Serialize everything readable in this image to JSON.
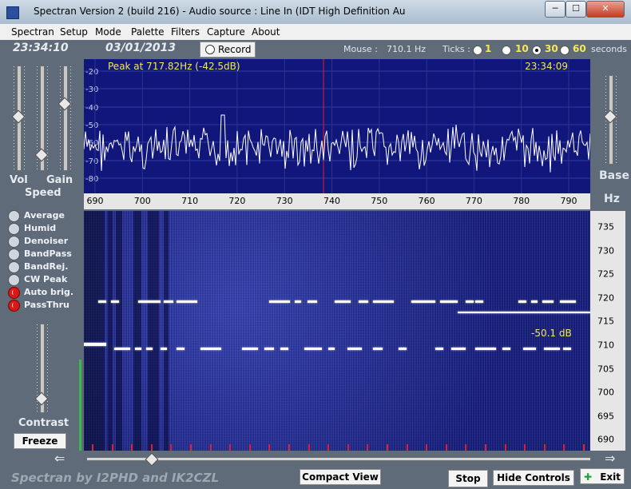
{
  "window": {
    "title": "Spectran Version 2 (build 216) - Audio source  :  Line In (IDT High Definition Au",
    "minimize_glyph": "─",
    "maximize_glyph": "☐",
    "close_glyph": "✕"
  },
  "menu": [
    "Spectran",
    "Setup",
    "Mode",
    "Palette",
    "Filters",
    "Capture",
    "About"
  ],
  "info": {
    "time": "23:34:10",
    "date": "03/01/2013",
    "record_label": "Record",
    "mouse_label": "Mouse :",
    "mouse_value": "710.1 Hz",
    "ticks_label": "Ticks :",
    "tick_options": [
      "1",
      "10",
      "30",
      "60"
    ],
    "tick_selected": "30",
    "seconds_label": "seconds"
  },
  "spectrum": {
    "peak_text": "Peak at  717.82Hz (-42.5dB)",
    "time": "23:34:09",
    "y_ticks": [
      "-20",
      "-30",
      "-40",
      "-50",
      "-60",
      "-70",
      "-80"
    ],
    "x_ticks": [
      "690",
      "700",
      "710",
      "720",
      "730",
      "740",
      "750",
      "760",
      "770",
      "780",
      "790"
    ]
  },
  "waterfall": {
    "db_label": "-50.1 dB",
    "y_ticks": [
      "735",
      "730",
      "725",
      "720",
      "715",
      "710",
      "705",
      "700",
      "695",
      "690"
    ],
    "unit": "Hz"
  },
  "left_panel": {
    "vol_label": "Vol",
    "gain_label": "Gain",
    "speed_label": "Speed",
    "contrast_label": "Contrast",
    "freeze_label": "Freeze",
    "options": [
      {
        "label": "Average",
        "on": false
      },
      {
        "label": "Humid",
        "on": false
      },
      {
        "label": "Denoiser",
        "on": false
      },
      {
        "label": "BandPass",
        "on": false
      },
      {
        "label": "BandRej.",
        "on": false
      },
      {
        "label": "CW Peak",
        "on": false
      },
      {
        "label": "Auto brig.",
        "on": true
      },
      {
        "label": "PassThru",
        "on": true
      }
    ]
  },
  "right_panel": {
    "base_label": "Base"
  },
  "bottom": {
    "credit": "Spectran  by I2PHD and IK2CZL",
    "compact_view_label": "Compact View",
    "stop_label": "Stop",
    "hide_controls_label": "Hide Controls",
    "exit_label": "Exit"
  },
  "colors": {
    "spectrum_bg": "#10167a",
    "accent_yellow": "#f4e85a",
    "marker_red": "#e0202e"
  }
}
